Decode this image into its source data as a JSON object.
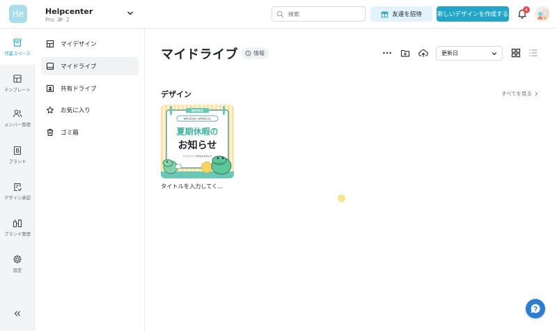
{
  "workspace": {
    "initials": "He",
    "name": "Helpcenter",
    "plan": "Pro",
    "members": "2"
  },
  "search": {
    "placeholder": "検索"
  },
  "header": {
    "invite_label": "友達を招待",
    "create_label": "新しいデザインを作成する",
    "notification_count": "4"
  },
  "rail": {
    "items": [
      {
        "label": "作業スペース",
        "icon": "workspace-icon"
      },
      {
        "label": "テンプレート",
        "icon": "template-icon"
      },
      {
        "label": "メンバー管理",
        "icon": "members-icon"
      },
      {
        "label": "ブランド",
        "icon": "brand-icon"
      },
      {
        "label": "デザイン承認",
        "icon": "approval-icon"
      },
      {
        "label": "ブランド管理",
        "icon": "brand-manage-icon"
      },
      {
        "label": "設定",
        "icon": "settings-icon"
      }
    ],
    "collapse_icon": "chevrons-left-icon"
  },
  "sidebar": {
    "items": [
      {
        "label": "マイデザイン",
        "icon": "layout-icon"
      },
      {
        "label": "マイドライブ",
        "icon": "drive-icon"
      },
      {
        "label": "共有ドライブ",
        "icon": "shared-drive-icon"
      },
      {
        "label": "お気に入り",
        "icon": "star-icon"
      },
      {
        "label": "ゴミ箱",
        "icon": "trash-icon"
      }
    ]
  },
  "main": {
    "title": "マイドライブ",
    "info_label": "情報",
    "sort_value": "更新日",
    "section_title": "デザイン",
    "see_all": "すべてを見る",
    "cards": [
      {
        "label": "タイトルを入力してく...",
        "thumb": {
          "badge": "NOTICE",
          "date": "8月1日(木)~8月5日(土)",
          "headline1": "夏期休暇の",
          "headline2": "お知らせ",
          "brand": "ミリカフェ | お休みのお知らせ"
        }
      }
    ]
  },
  "colors": {
    "accent": "#22a5c6",
    "badge": "#e5484d",
    "help": "#2a7dd1"
  }
}
